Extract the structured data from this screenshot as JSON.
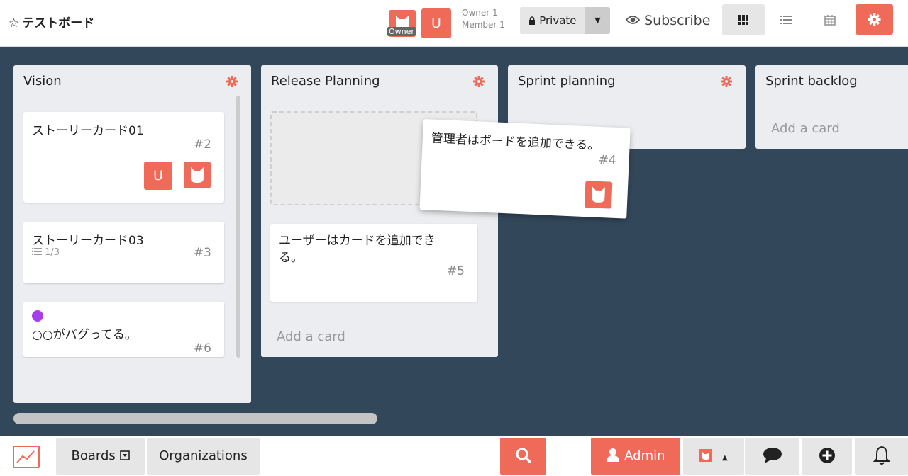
{
  "header": {
    "star_icon": "☆",
    "board_title": "テストボード",
    "owner_tag": "Owner",
    "member_initial": "U",
    "owner_count": "Owner 1",
    "member_count": "Member 1",
    "privacy_label": "Private",
    "subscribe_label": "Subscribe",
    "accent_color": "#f06a5a"
  },
  "lists": [
    {
      "title": "Vision",
      "cards": [
        {
          "title": "ストーリーカード01",
          "number": "#2",
          "member_initial": "U"
        },
        {
          "title": "ストーリーカード03",
          "number": "#3",
          "checklist": "1/3"
        },
        {
          "title": "○○がバグってる。",
          "number": "#6",
          "label_color": "#a63fe8"
        }
      ]
    },
    {
      "title": "Release Planning",
      "cards": [
        {
          "title_line1": "ユーザーはカードを追加でき",
          "title_line2": "る。",
          "number": "#5"
        }
      ],
      "add_card": "Add a card"
    },
    {
      "title": "Sprint planning",
      "cards": []
    },
    {
      "title": "Sprint backlog",
      "cards": [],
      "add_card": "Add a card"
    }
  ],
  "dragging_card": {
    "title": "管理者はボードを追加できる。",
    "number": "#4"
  },
  "footer": {
    "boards_label": "Boards",
    "organizations_label": "Organizations",
    "admin_label": "Admin"
  }
}
